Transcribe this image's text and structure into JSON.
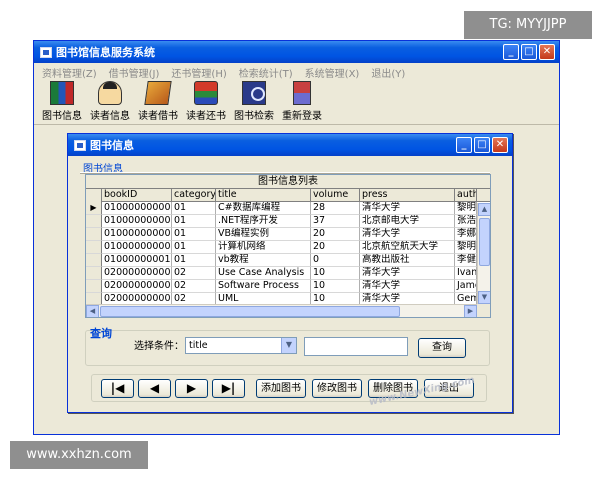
{
  "main_window": {
    "title": "图书馆信息服务系统",
    "menu": [
      "资料管理(Z)",
      "借书管理(J)",
      "还书管理(H)",
      "检索统计(T)",
      "系统管理(X)",
      "退出(Y)"
    ],
    "toolbar": [
      {
        "label": "图书信息",
        "icon": "books-icon"
      },
      {
        "label": "读者信息",
        "icon": "reader-icon"
      },
      {
        "label": "读者借书",
        "icon": "borrow-icon"
      },
      {
        "label": "读者还书",
        "icon": "return-icon"
      },
      {
        "label": "图书检索",
        "icon": "search-icon"
      },
      {
        "label": "重新登录",
        "icon": "relogin-icon"
      }
    ]
  },
  "dialog": {
    "title": "图书信息",
    "group_label": "图书信息",
    "grid": {
      "caption": "图书信息列表",
      "columns": [
        "bookID",
        "categoryID",
        "title",
        "volume",
        "press",
        "autho"
      ],
      "rows": [
        {
          "current": true,
          "cells": [
            "010000000001",
            "01",
            "C#数据库编程",
            "28",
            "清华大学",
            "黎明"
          ]
        },
        {
          "current": false,
          "cells": [
            "010000000002",
            "01",
            ".NET程序开发",
            "37",
            "北京邮电大学",
            "张浩"
          ]
        },
        {
          "current": false,
          "cells": [
            "010000000003",
            "01",
            "VB编程实例",
            "20",
            "清华大学",
            "李娜"
          ]
        },
        {
          "current": false,
          "cells": [
            "010000000004",
            "01",
            "计算机网络",
            "20",
            "北京航空航天大学",
            "黎明"
          ]
        },
        {
          "current": false,
          "cells": [
            "010000000011",
            "01",
            "vb教程",
            "0",
            "高教出版社",
            "李健"
          ]
        },
        {
          "current": false,
          "cells": [
            "020000000001",
            "02",
            "Use Case Analysis",
            "10",
            "清华大学",
            "Ivan"
          ]
        },
        {
          "current": false,
          "cells": [
            "020000000002",
            "02",
            "Software Process",
            "10",
            "清华大学",
            "Jame"
          ]
        },
        {
          "current": false,
          "cells": [
            "020000000003",
            "02",
            "UML",
            "10",
            "清华大学",
            "Geml"
          ]
        }
      ]
    },
    "query": {
      "title": "查询",
      "condition_label": "选择条件：",
      "condition_value": "title",
      "input_value": "",
      "button": "查询"
    },
    "nav": {
      "first": "|◀",
      "prev": "◀",
      "next": "▶",
      "last": "▶|",
      "add": "添加图书",
      "edit": "修改图书",
      "delete": "删除图书",
      "exit": "退出"
    },
    "watermark": "www.NewXing.com"
  },
  "overlays": {
    "top_right": "TG: MYYJJPP",
    "bottom_left": "www.xxhzn.com"
  }
}
